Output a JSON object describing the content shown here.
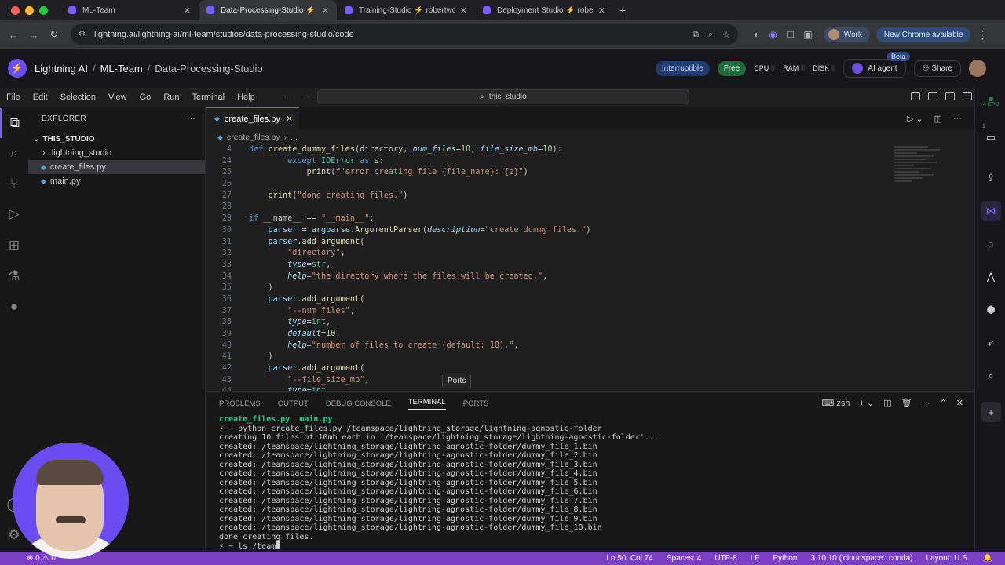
{
  "browser": {
    "tabs": [
      {
        "title": "ML-Team",
        "active": false
      },
      {
        "title": "Data-Processing-Studio ⚡ ro",
        "active": true
      },
      {
        "title": "Training-Studio ⚡ robertwo",
        "active": false
      },
      {
        "title": "Deployment Studio ⚡ robert",
        "active": false
      }
    ],
    "url": "lightning.ai/lightning-ai/ml-team/studios/data-processing-studio/code",
    "profile_label": "Work",
    "new_chrome_label": "New Chrome available"
  },
  "lightning": {
    "org": "Lightning AI",
    "team": "ML-Team",
    "studio": "Data-Processing-Studio",
    "interruptible_label": "Interruptible",
    "free_label": "Free",
    "cpu_label": "CPU",
    "ram_label": "RAM",
    "disk_label": "DISK",
    "ai_agent_label": "AI agent",
    "beta_label": "Beta",
    "share_label": "Share"
  },
  "menu": [
    "File",
    "Edit",
    "Selection",
    "View",
    "Go",
    "Run",
    "Terminal",
    "Help"
  ],
  "command_center": "this_studio",
  "explorer": {
    "title": "EXPLORER",
    "root": "THIS_STUDIO",
    "items": [
      {
        "name": ".lightning_studio",
        "type": "folder"
      },
      {
        "name": "create_files.py",
        "type": "py",
        "selected": true
      },
      {
        "name": "main.py",
        "type": "py"
      }
    ]
  },
  "editor": {
    "tab": "create_files.py",
    "breadcrumb_file": "create_files.py",
    "breadcrumb_more": "...",
    "lines": [
      {
        "n": "4",
        "src": "def create_dummy_files(directory, num_files=10, file_size_mb=10):"
      },
      {
        "n": "24",
        "src": "        except IOError as e:"
      },
      {
        "n": "25",
        "src": "            print(f\"error creating file {file_name}: {e}\")"
      },
      {
        "n": "26",
        "src": ""
      },
      {
        "n": "27",
        "src": "    print(\"done creating files.\")"
      },
      {
        "n": "28",
        "src": ""
      },
      {
        "n": "29",
        "src": "if __name__ == \"__main__\":"
      },
      {
        "n": "30",
        "src": "    parser = argparse.ArgumentParser(description=\"create dummy files.\")"
      },
      {
        "n": "31",
        "src": "    parser.add_argument("
      },
      {
        "n": "32",
        "src": "        \"directory\","
      },
      {
        "n": "33",
        "src": "        type=str,"
      },
      {
        "n": "34",
        "src": "        help=\"the directory where the files will be created.\","
      },
      {
        "n": "35",
        "src": "    )"
      },
      {
        "n": "36",
        "src": "    parser.add_argument("
      },
      {
        "n": "37",
        "src": "        \"--num_files\","
      },
      {
        "n": "38",
        "src": "        type=int,"
      },
      {
        "n": "39",
        "src": "        default=10,"
      },
      {
        "n": "40",
        "src": "        help=\"number of files to create (default: 10).\","
      },
      {
        "n": "41",
        "src": "    )"
      },
      {
        "n": "42",
        "src": "    parser.add_argument("
      },
      {
        "n": "43",
        "src": "        \"--file_size_mb\","
      },
      {
        "n": "44",
        "src": "        type=int,"
      }
    ],
    "tooltip": "Ports"
  },
  "panel": {
    "tabs": [
      "PROBLEMS",
      "OUTPUT",
      "DEBUG CONSOLE",
      "TERMINAL",
      "PORTS"
    ],
    "active_tab": "TERMINAL",
    "shell": "zsh",
    "terminal_lines": [
      "create_files.py  main.py",
      "⚡ ~ python create_files.py /teamspace/lightning_storage/lightning-agnostic-folder",
      "creating 10 files of 10mb each in '/teamspace/lightning_storage/lightning-agnostic-folder'...",
      "created: /teamspace/lightning_storage/lightning-agnostic-folder/dummy_file_1.bin",
      "created: /teamspace/lightning_storage/lightning-agnostic-folder/dummy_file_2.bin",
      "created: /teamspace/lightning_storage/lightning-agnostic-folder/dummy_file_3.bin",
      "created: /teamspace/lightning_storage/lightning-agnostic-folder/dummy_file_4.bin",
      "created: /teamspace/lightning_storage/lightning-agnostic-folder/dummy_file_5.bin",
      "created: /teamspace/lightning_storage/lightning-agnostic-folder/dummy_file_6.bin",
      "created: /teamspace/lightning_storage/lightning-agnostic-folder/dummy_file_7.bin",
      "created: /teamspace/lightning_storage/lightning-agnostic-folder/dummy_file_8.bin",
      "created: /teamspace/lightning_storage/lightning-agnostic-folder/dummy_file_9.bin",
      "created: /teamspace/lightning_storage/lightning-agnostic-folder/dummy_file_10.bin",
      "done creating files."
    ],
    "prompt_input": "⚡ ~ ls /team"
  },
  "right_bar": {
    "cpu_label": "4 CPU",
    "badge": "1"
  },
  "status": {
    "errors": "0",
    "warnings": "0",
    "position": "Ln 50, Col 74",
    "spaces": "Spaces: 4",
    "encoding": "UTF-8",
    "eol": "LF",
    "language": "Python",
    "interpreter": "3.10.10 ('cloudspace': conda)",
    "layout": "Layout: U.S."
  },
  "colors": {
    "accent": "#7a5cff",
    "status_bar": "#7a3fc4",
    "free_badge": "#1f6b3c",
    "interruptible_badge": "#233a70"
  }
}
